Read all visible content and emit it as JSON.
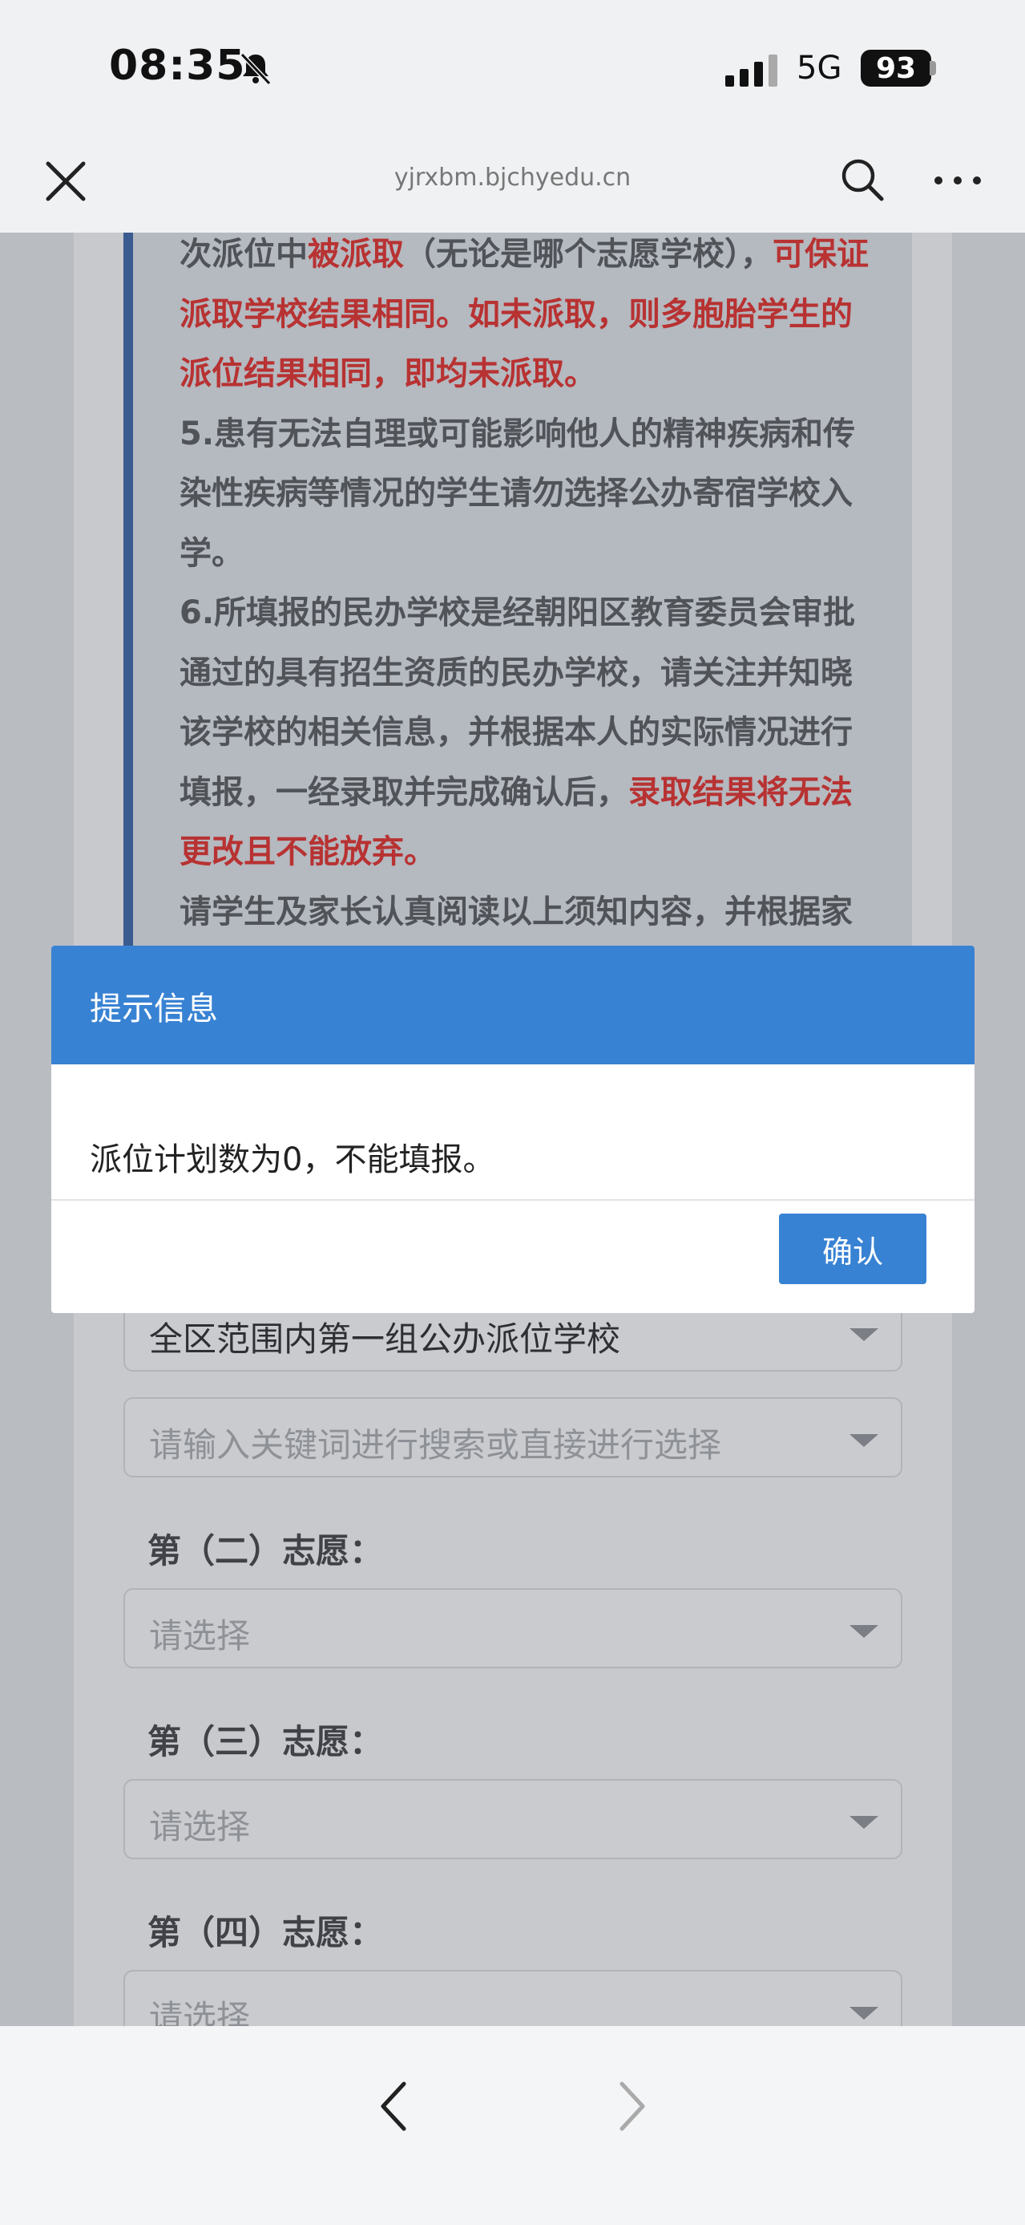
{
  "status_bar": {
    "time": "08:35",
    "network": "5G",
    "battery": "93"
  },
  "browser": {
    "url": "yjrxbm.bjchyedu.cn"
  },
  "notice": {
    "segments": [
      {
        "text": "次派位中",
        "red": false
      },
      {
        "text": "被派取",
        "red": true
      },
      {
        "text": "（无论是哪个志愿学校），",
        "red": false
      },
      {
        "text": "可保证派取学校结果相同。如未派取，则多胞胎学生的派位结果相同，即均未派取。",
        "red": true
      },
      {
        "text": "5.患有无法自理或可能影响他人的精神疾病和传染性疾病等情况的学生请勿选择公办寄宿学校入学。",
        "red": false,
        "break": true
      },
      {
        "text": "6.所填报的民办学校是经朝阳区教育委员会审批通过的具有招生资质的民办学校，请关注并知晓该学校的相关信息，并根据本人的实际情况进行填报，一经录取并完成确认后，",
        "red": false,
        "break": true
      },
      {
        "text": "录取结果将无法更改且不能放弃。",
        "red": true
      },
      {
        "text": "请学生及家长认真阅读以上须知内容，并根据家庭实际情况进行填报。",
        "red": false,
        "break": true
      }
    ]
  },
  "form": {
    "group_select": "全区范围内第一组公办派位学校",
    "search_placeholder": "请输入关键词进行搜索或直接进行选择",
    "choice2_label": "第（二）志愿：",
    "choice3_label": "第（三）志愿：",
    "choice4_label": "第（四）志愿：",
    "select_placeholder": "请选择"
  },
  "modal": {
    "title": "提示信息",
    "message": "派位计划数为0，不能填报。",
    "confirm_label": "确认"
  },
  "colors": {
    "primary": "#3882d3",
    "emphasis_red": "#b83232"
  },
  "icons": [
    "bell-slash-icon",
    "signal-icon",
    "battery-icon",
    "close-icon",
    "search-icon",
    "more-icon",
    "chevron-down-icon",
    "back-arrow-icon",
    "forward-arrow-icon"
  ]
}
